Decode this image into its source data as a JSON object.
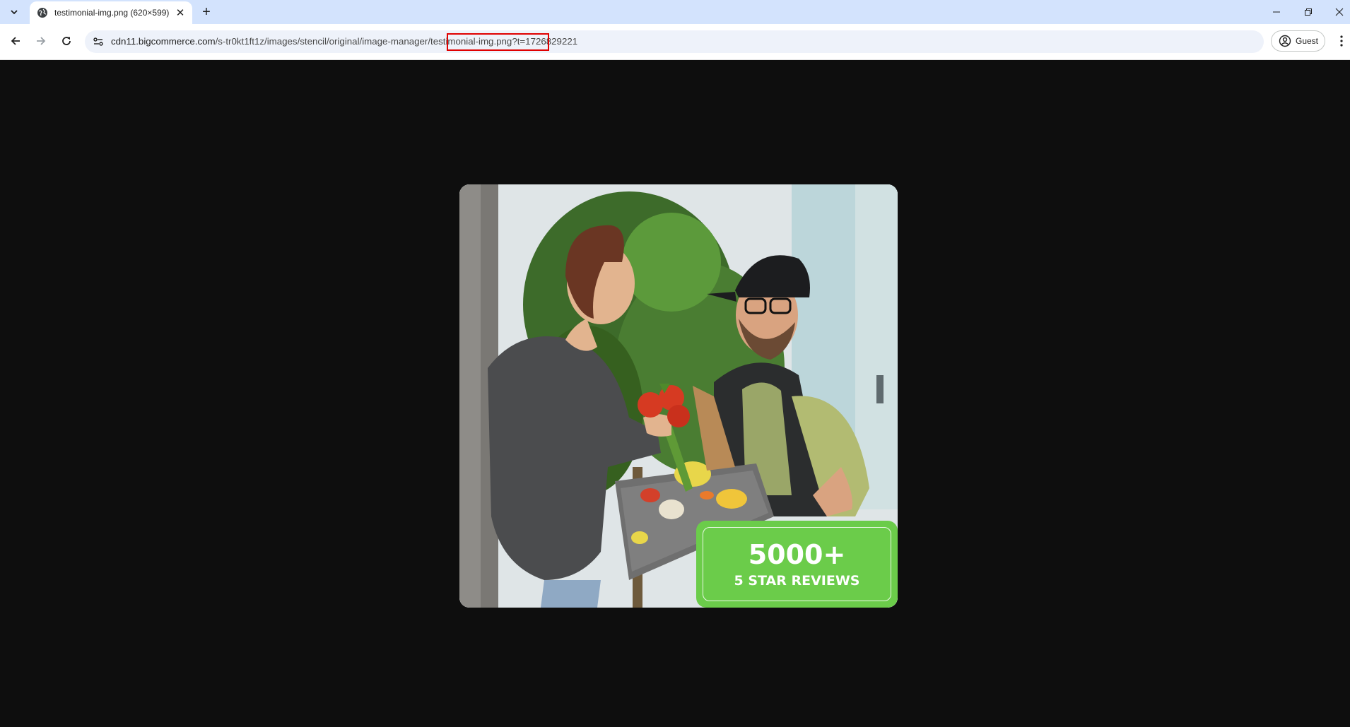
{
  "browser": {
    "tab": {
      "title": "testimonial-img.png (620×599)"
    },
    "address_bar": {
      "host": "cdn11.bigcommerce.com",
      "path": "/s-tr0kt1ft1z/images/stencil/original/image-manager/testimonial-img.png?t=1726829221"
    },
    "profile_label": "Guest"
  },
  "image": {
    "alt": "testimonial-img.png",
    "badge": {
      "count": "5000+",
      "label": "5 STAR REVIEWS"
    }
  },
  "colors": {
    "tabbar": "#d3e3fd",
    "viewer_bg": "#0e0e0e",
    "badge": "#6bcc4a",
    "highlight": "#e00000"
  }
}
